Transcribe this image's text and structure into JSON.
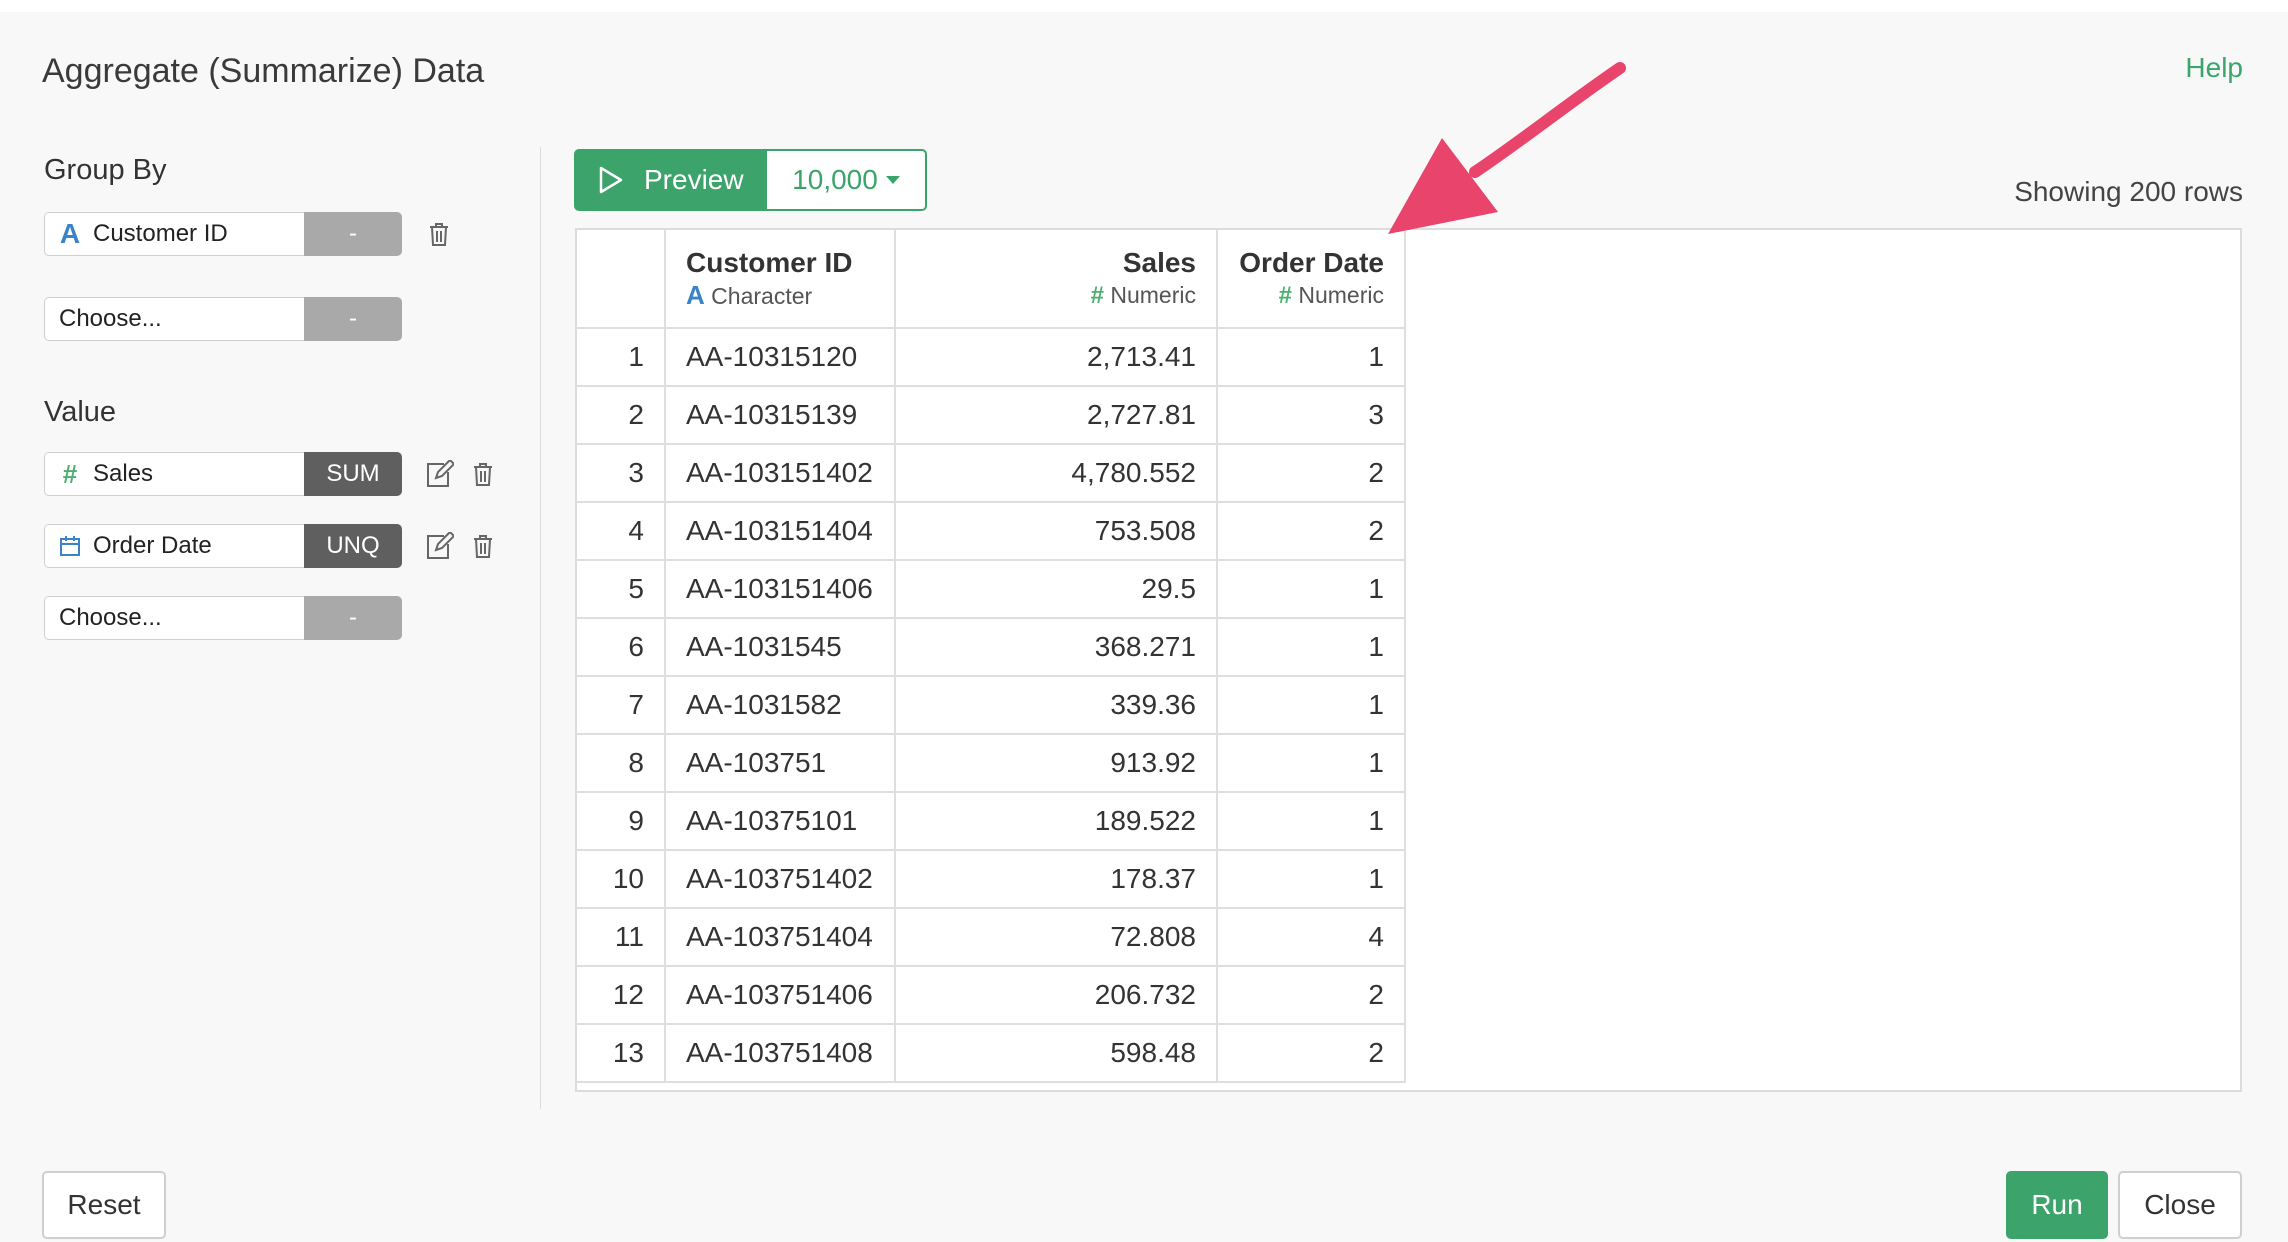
{
  "dialog": {
    "title": "Aggregate (Summarize) Data",
    "help_label": "Help"
  },
  "group_by": {
    "label": "Group By",
    "fields": [
      {
        "name": "Customer ID",
        "type_icon": "character-icon",
        "agg": "-"
      },
      {
        "name": "Choose...",
        "type_icon": "",
        "agg": "-"
      }
    ]
  },
  "value": {
    "label": "Value",
    "fields": [
      {
        "name": "Sales",
        "type_icon": "numeric-icon",
        "agg": "SUM"
      },
      {
        "name": "Order Date",
        "type_icon": "calendar-icon",
        "agg": "UNQ"
      },
      {
        "name": "Choose...",
        "type_icon": "",
        "agg": "-"
      }
    ]
  },
  "preview": {
    "button_label": "Preview",
    "rows_option": "10,000",
    "showing_text": "Showing 200 rows"
  },
  "table": {
    "columns": [
      {
        "name": "Customer ID",
        "type": "Character",
        "type_icon": "character-icon"
      },
      {
        "name": "Sales",
        "type": "Numeric",
        "type_icon": "numeric-icon"
      },
      {
        "name": "Order Date",
        "type": "Numeric",
        "type_icon": "numeric-icon"
      }
    ],
    "type_glyphs": {
      "character": "A",
      "numeric": "#"
    },
    "rows": [
      [
        "1",
        "AA-10315120",
        "2,713.41",
        "1"
      ],
      [
        "2",
        "AA-10315139",
        "2,727.81",
        "3"
      ],
      [
        "3",
        "AA-103151402",
        "4,780.552",
        "2"
      ],
      [
        "4",
        "AA-103151404",
        "753.508",
        "2"
      ],
      [
        "5",
        "AA-103151406",
        "29.5",
        "1"
      ],
      [
        "6",
        "AA-1031545",
        "368.271",
        "1"
      ],
      [
        "7",
        "AA-1031582",
        "339.36",
        "1"
      ],
      [
        "8",
        "AA-103751",
        "913.92",
        "1"
      ],
      [
        "9",
        "AA-10375101",
        "189.522",
        "1"
      ],
      [
        "10",
        "AA-103751402",
        "178.37",
        "1"
      ],
      [
        "11",
        "AA-103751404",
        "72.808",
        "4"
      ],
      [
        "12",
        "AA-103751406",
        "206.732",
        "2"
      ],
      [
        "13",
        "AA-103751408",
        "598.48",
        "2"
      ]
    ]
  },
  "footer": {
    "reset_label": "Reset",
    "run_label": "Run",
    "close_label": "Close"
  },
  "colors": {
    "accent_green": "#3ca36b",
    "annotation_arrow": "#e8446c",
    "character_blue": "#3a83c8",
    "numeric_green": "#4caf6e"
  }
}
